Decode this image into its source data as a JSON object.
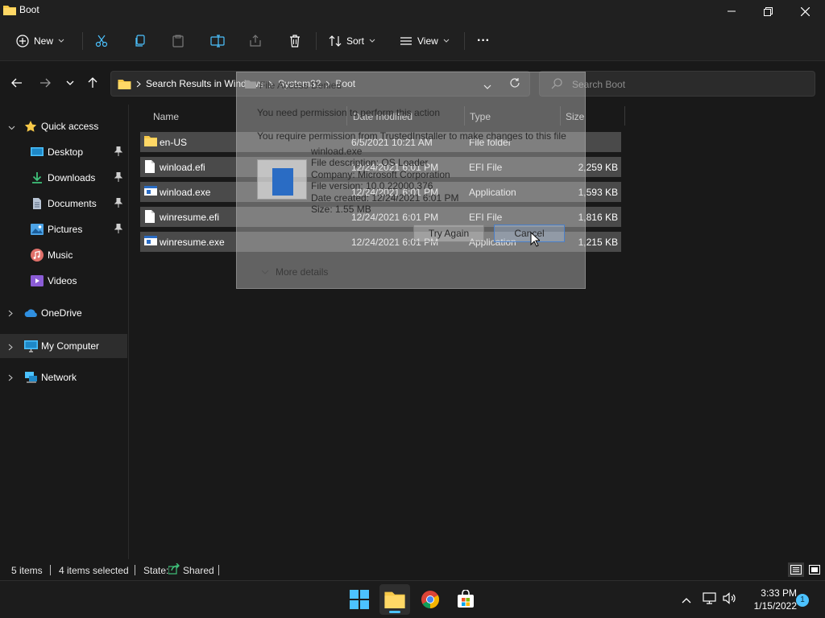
{
  "window": {
    "title": "Boot"
  },
  "toolbar": {
    "new_label": "New",
    "sort_label": "Sort",
    "view_label": "View",
    "more_label": "···"
  },
  "address": {
    "crumbs": [
      "Search Results in Windows",
      "System32",
      "Boot"
    ]
  },
  "search": {
    "placeholder": "Search Boot"
  },
  "nav": {
    "quick_access": "Quick access",
    "items": [
      {
        "label": "Desktop",
        "icon": "desktop-icon"
      },
      {
        "label": "Downloads",
        "icon": "downloads-icon"
      },
      {
        "label": "Documents",
        "icon": "documents-icon"
      },
      {
        "label": "Pictures",
        "icon": "pictures-icon"
      },
      {
        "label": "Music",
        "icon": "music-icon"
      },
      {
        "label": "Videos",
        "icon": "videos-icon"
      }
    ],
    "onedrive": "OneDrive",
    "my_computer": "My Computer",
    "network": "Network"
  },
  "columns": {
    "name": "Name",
    "date": "Date modified",
    "type": "Type",
    "size": "Size"
  },
  "files": [
    {
      "name": "en-US",
      "date": "6/5/2021 10:21 AM",
      "type": "File folder",
      "size": ""
    },
    {
      "name": "winload.efi",
      "date": "12/24/2021 6:01 PM",
      "type": "EFI File",
      "size": "2,259 KB"
    },
    {
      "name": "winload.exe",
      "date": "12/24/2021 6:01 PM",
      "type": "Application",
      "size": "1,593 KB"
    },
    {
      "name": "winresume.efi",
      "date": "12/24/2021 6:01 PM",
      "type": "EFI File",
      "size": "1,816 KB"
    },
    {
      "name": "winresume.exe",
      "date": "12/24/2021 6:01 PM",
      "type": "Application",
      "size": "1,215 KB"
    }
  ],
  "status": {
    "items": "5 items",
    "selected": "4 items selected",
    "state_label": "State:",
    "state_value": "Shared"
  },
  "dialog": {
    "title": "File Access Denied",
    "heading": "You need permission to perform this action",
    "message": "You require permission from TrustedInstaller to make changes to this file",
    "file_name": "winload.exe",
    "description": "File description: OS Loader",
    "company": "Company: Microsoft Corporation",
    "version": "File version: 10.0.22000.376",
    "created": "Date created: 12/24/2021 6:01 PM",
    "size": "Size: 1.55 MB",
    "try_again": "Try Again",
    "cancel": "Cancel",
    "more_details": "More details"
  },
  "taskbar": {
    "time": "3:33 PM",
    "date": "1/15/2022",
    "notifications": "1"
  },
  "colors": {
    "accent": "#4cc2ff",
    "folder": "#f7c948",
    "selection": "#4a4a4a"
  }
}
